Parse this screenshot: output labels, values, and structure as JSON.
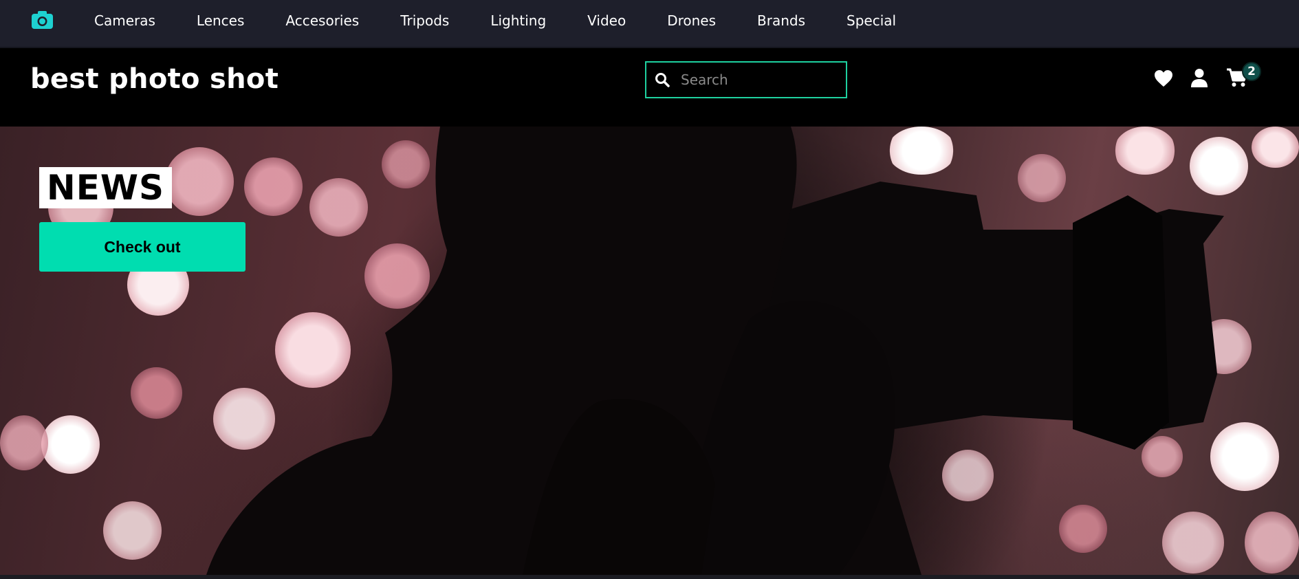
{
  "topnav": {
    "logo_icon": "camera-icon",
    "accent": "#1ed1d1",
    "items": [
      {
        "label": "Cameras"
      },
      {
        "label": "Lences"
      },
      {
        "label": "Accesories"
      },
      {
        "label": "Tripods"
      },
      {
        "label": "Lighting"
      },
      {
        "label": "Video"
      },
      {
        "label": "Drones"
      },
      {
        "label": "Brands"
      },
      {
        "label": "Special"
      }
    ]
  },
  "header": {
    "brand": "best photo shot",
    "search": {
      "placeholder": "Search",
      "value": "",
      "icon": "search-icon",
      "border_color": "#1ed1a0"
    },
    "icons": [
      "heart-icon",
      "user-icon",
      "cart-icon"
    ],
    "cart_count": "2"
  },
  "hero": {
    "tag": "NEWS",
    "cta_label": "Check out",
    "cta_color": "#00ddb0"
  }
}
